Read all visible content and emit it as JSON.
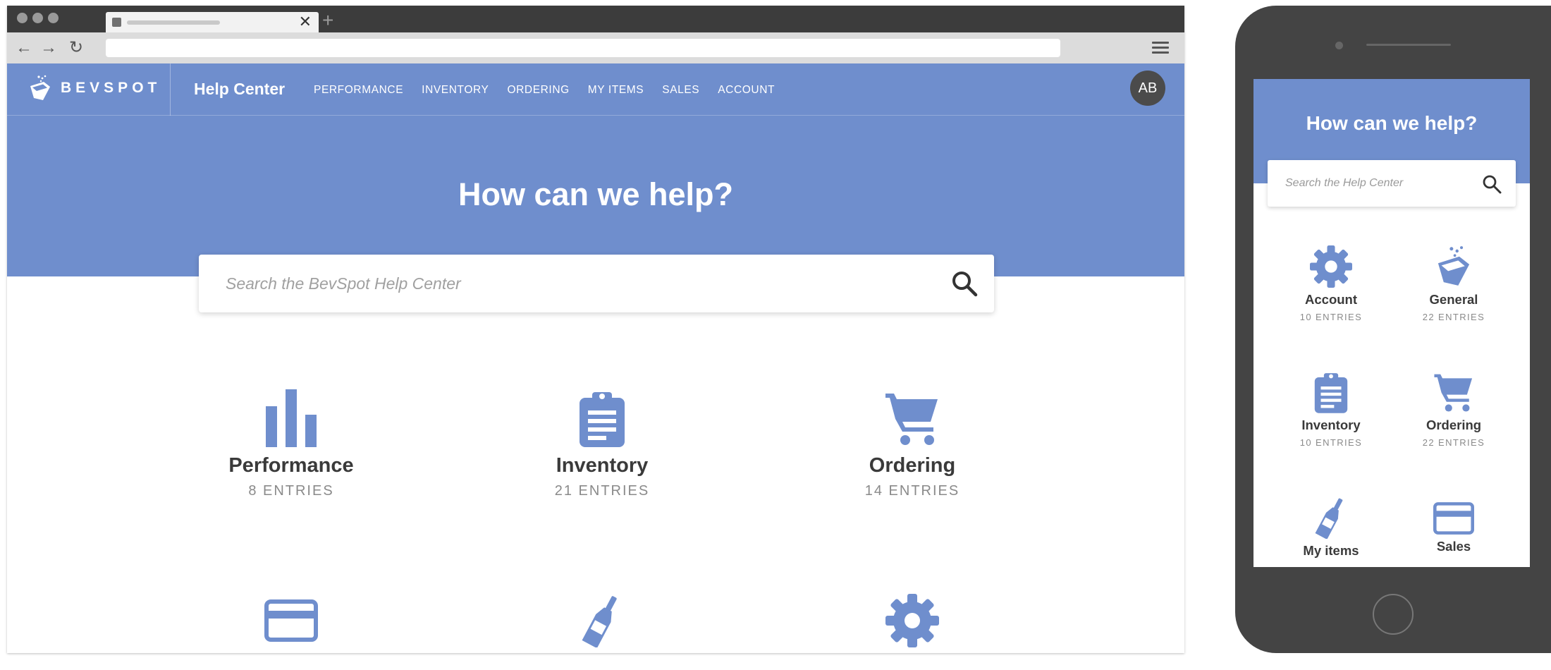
{
  "brand": {
    "logo_text": "BEVSPOT",
    "accent_color": "#6f8ecd",
    "avatar_initials": "AB"
  },
  "browser": {
    "tab_close": "✕",
    "new_tab": "+",
    "back": "←",
    "forward": "→",
    "reload": "↻"
  },
  "header": {
    "title": "Help Center",
    "nav": [
      "PERFORMANCE",
      "INVENTORY",
      "ORDERING",
      "MY ITEMS",
      "SALES",
      "ACCOUNT"
    ]
  },
  "hero": {
    "title": "How can we help?",
    "search_placeholder": "Search the BevSpot Help Center"
  },
  "categories": [
    {
      "name": "Performance",
      "entries": "8 ENTRIES",
      "icon": "bar-chart-icon"
    },
    {
      "name": "Inventory",
      "entries": "21 ENTRIES",
      "icon": "clipboard-icon"
    },
    {
      "name": "Ordering",
      "entries": "14 ENTRIES",
      "icon": "cart-icon"
    },
    {
      "icon": "credit-card-icon"
    },
    {
      "icon": "bottle-icon"
    },
    {
      "icon": "gear-icon"
    }
  ],
  "mobile": {
    "title": "How can we help?",
    "search_placeholder": "Search the Help Center",
    "categories": [
      {
        "name": "Account",
        "entries": "10 ENTRIES",
        "icon": "gear-icon"
      },
      {
        "name": "General",
        "entries": "22 ENTRIES",
        "icon": "glass-icon"
      },
      {
        "name": "Inventory",
        "entries": "10 ENTRIES",
        "icon": "clipboard-icon"
      },
      {
        "name": "Ordering",
        "entries": "22 ENTRIES",
        "icon": "cart-icon"
      },
      {
        "name": "My items",
        "icon": "bottle-icon"
      },
      {
        "name": "Sales",
        "icon": "credit-card-icon"
      }
    ]
  }
}
